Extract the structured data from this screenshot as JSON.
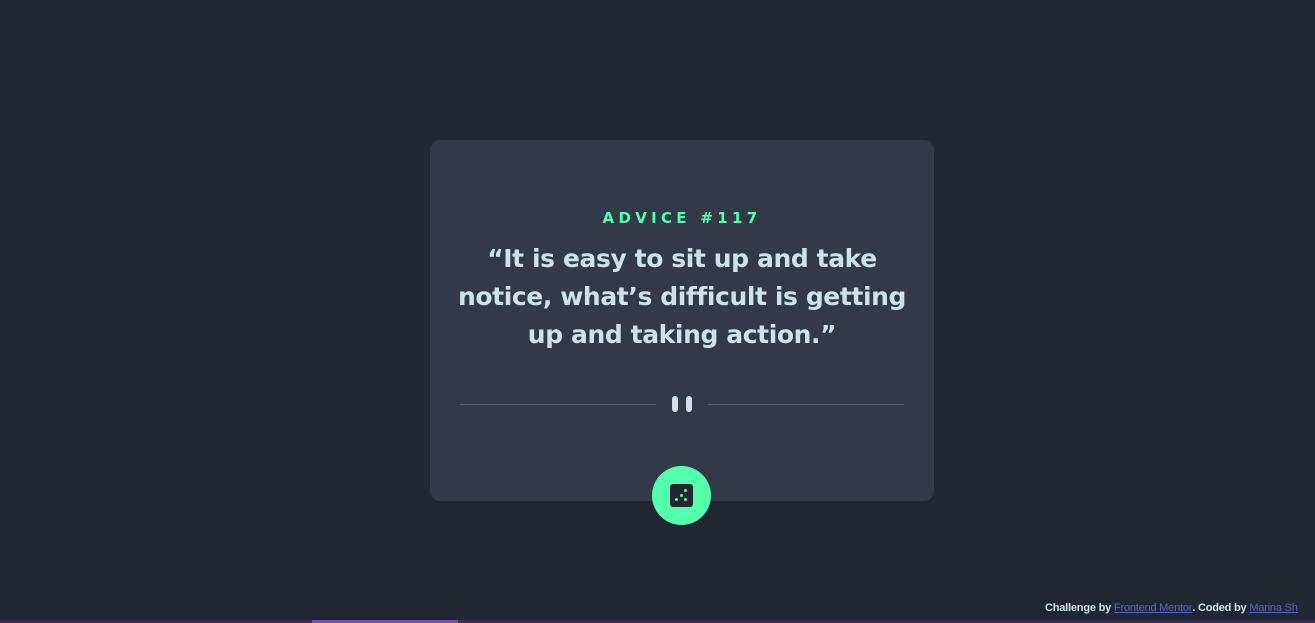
{
  "card": {
    "advice_label": "ADVICE #117",
    "quote": "“It is easy to sit up and take notice, what’s difficult is getting up and taking action.”"
  },
  "divider": {
    "icon": "pause-icon"
  },
  "dice_button": {
    "icon": "dice-icon"
  },
  "attribution": {
    "challenge_prefix": "Challenge by ",
    "challenge_link": "Frontend Mentor",
    "coded_prefix": ". Coded by ",
    "coded_link": "Marina Sh"
  },
  "colors": {
    "background": "#202632",
    "card": "#323a49",
    "accent": "#53ffaa",
    "text": "#cee3e9",
    "divider": "#4f5d74",
    "link": "#5a63c8"
  }
}
